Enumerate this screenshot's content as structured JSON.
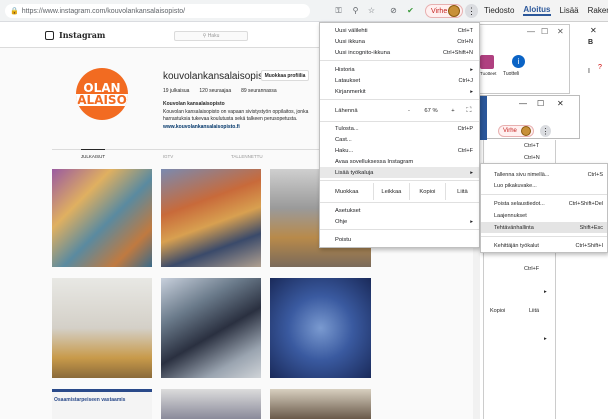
{
  "browser": {
    "url": "https://www.instagram.com/kouvolankansalaisopisto/",
    "error_label": "Virhe",
    "toolbar_icons": [
      "key-icon",
      "zoom-icon",
      "star-icon",
      "extension-icon",
      "extension-green-icon"
    ]
  },
  "instagram": {
    "logo_text": "Instagram",
    "search_placeholder": "Haku",
    "profile_logo_line1": "OLAN",
    "profile_logo_line2": "ALAISO",
    "username": "kouvolankansalaisopisto",
    "edit_button": "Muokkaa profiilia",
    "stats": [
      "19 julkaisua",
      "120 seuraajaa",
      "89 seurannassa"
    ],
    "bio_name": "Kouvolan kansalaisopisto",
    "bio_line1": "Kouvolan kansalaisopisto on vapaan sivistystyön oppilaitos, jonka",
    "bio_line2": "harrastuksia tukevaa koulutusta sekä talkeen perusopetusta.",
    "bio_link": "www.kouvolankansalaisopisto.fi",
    "tabs": [
      "JULKAISUT",
      "IGTV",
      "TALLENNETTU",
      "MERKITYT"
    ],
    "tile_caption": "Osaamistarpeiseen vastaamis"
  },
  "word": {
    "tabs": [
      "Tiedosto",
      "Aloitus",
      "Lisää",
      "Rakenne"
    ],
    "teach_label_1": "Tuotteet",
    "teach_label_2": "Tuotteli"
  },
  "chrome_menu": {
    "new_tab": "Uusi välilehti",
    "new_tab_sc": "Ctrl+T",
    "new_window": "Uusi ikkuna",
    "new_window_sc": "Ctrl+N",
    "incognito": "Uusi incognito-ikkuna",
    "incognito_sc": "Ctrl+Shift+N",
    "history": "Historia",
    "downloads": "Lataukset",
    "downloads_sc": "Ctrl+J",
    "bookmarks": "Kirjanmerkit",
    "zoom": "Lähennä",
    "zoom_minus": "-",
    "zoom_value": "67 %",
    "zoom_plus": "+",
    "print": "Tulosta...",
    "print_sc": "Ctrl+P",
    "cast": "Cast...",
    "find": "Haku...",
    "find_sc": "Ctrl+F",
    "open_app": "Avaa sovelluksessa Instagram",
    "more_tools": "Lisää työkaluja",
    "edit": "Muokkaa",
    "cut": "Leikkaa",
    "copy": "Kopioi",
    "paste": "Liitä",
    "settings": "Asetukset",
    "help": "Ohje",
    "exit": "Poistu"
  },
  "submenu": {
    "save_page": "Tallenna sivu nimellä...",
    "save_page_sc": "Ctrl+S",
    "create_shortcut": "Luo pikakuvake...",
    "clear_data": "Poista selaustiedot...",
    "clear_data_sc": "Ctrl+Shift+Del",
    "extensions": "Laajennukset",
    "task_manager": "Tehtävänhallinta",
    "task_manager_sc": "Shift+Esc",
    "dev_tools": "Kehittäjän työkalut",
    "dev_tools_sc": "Ctrl+Shift+I"
  },
  "background_menu": {
    "sc1": "Ctrl+T",
    "sc2": "Ctrl+N",
    "sc3": "Ctrl+F",
    "copy": "Kopioi",
    "paste": "Liitä"
  }
}
